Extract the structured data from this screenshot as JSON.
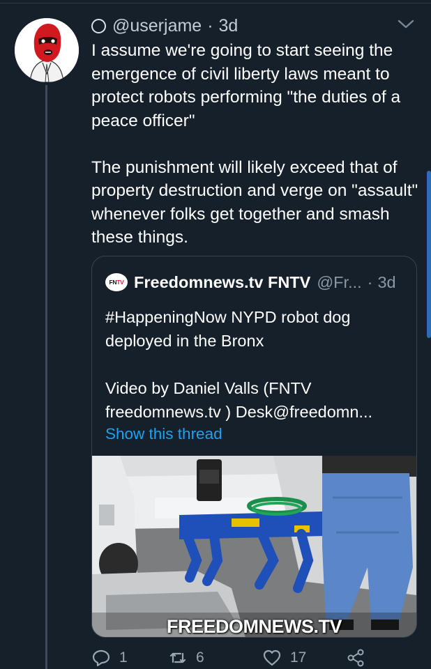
{
  "tweet": {
    "status_icon": "ring-icon",
    "handle": "@userjame",
    "separator": "·",
    "time": "3d",
    "menu_icon": "chevron-down-icon",
    "avatar_icon": "red-balaclava-avatar",
    "paragraphs": [
      "I assume we're going to start seeing the emergence of civil liberty laws meant to protect robots performing \"the duties of a peace officer\"",
      "The punishment will likely exceed that of property destruction and verge on \"assault\" whenever folks get together and smash these things."
    ]
  },
  "quoted": {
    "logo_text_a": "FN",
    "logo_text_b": "TV",
    "name": "Freedomnews.tv FNTV",
    "handle": "@Fr...",
    "separator": "·",
    "time": "3d",
    "paragraphs": [
      "#HappeningNow NYPD robot dog deployed in the Bronx",
      "Video by Daniel Valls (FNTV freedomnews.tv ) Desk@freedomn..."
    ],
    "show_thread": "Show this thread",
    "media_icon": "robot-dog-photo",
    "watermark": "FREEDOMNEWS.TV"
  },
  "actions": {
    "reply": {
      "icon": "reply-icon",
      "count": "1"
    },
    "retweet": {
      "icon": "retweet-icon",
      "count": "6"
    },
    "like": {
      "icon": "heart-icon",
      "count": "17"
    },
    "share": {
      "icon": "share-icon"
    }
  },
  "colors": {
    "background": "#15202b",
    "link": "#1da1f2",
    "secondary_text": "#8b98a5",
    "border": "#38444d"
  }
}
